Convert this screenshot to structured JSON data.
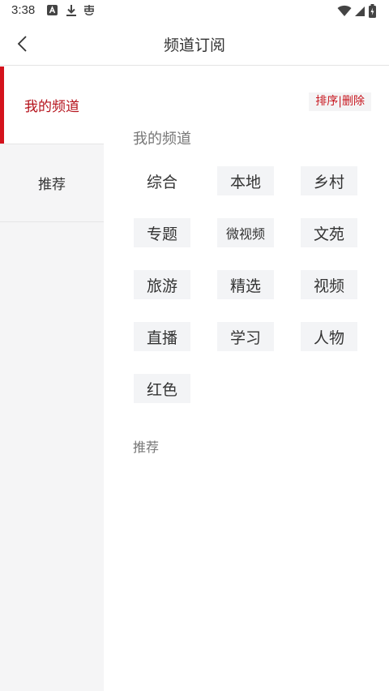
{
  "status_bar": {
    "time": "3:38"
  },
  "header": {
    "title": "频道订阅"
  },
  "sidebar": {
    "items": [
      {
        "label": "我的频道",
        "active": true
      },
      {
        "label": "推荐",
        "active": false
      }
    ]
  },
  "main": {
    "sort_delete_label": "排序|删除",
    "my_channels_title": "我的频道",
    "recommend_title": "推荐",
    "channels": [
      "综合",
      "本地",
      "乡村",
      "专题",
      "微视频",
      "文苑",
      "旅游",
      "精选",
      "视频",
      "直播",
      "学习",
      "人物",
      "红色"
    ]
  },
  "colors": {
    "accent": "#d4121c",
    "chip_bg": "#f3f4f6",
    "sidebar_bg": "#f5f5f6"
  },
  "icons": {
    "back": "chevron-left-icon",
    "status": [
      "notification-a-icon",
      "download-icon",
      "app-icon",
      "wifi-icon",
      "signal-icon",
      "battery-icon"
    ]
  }
}
